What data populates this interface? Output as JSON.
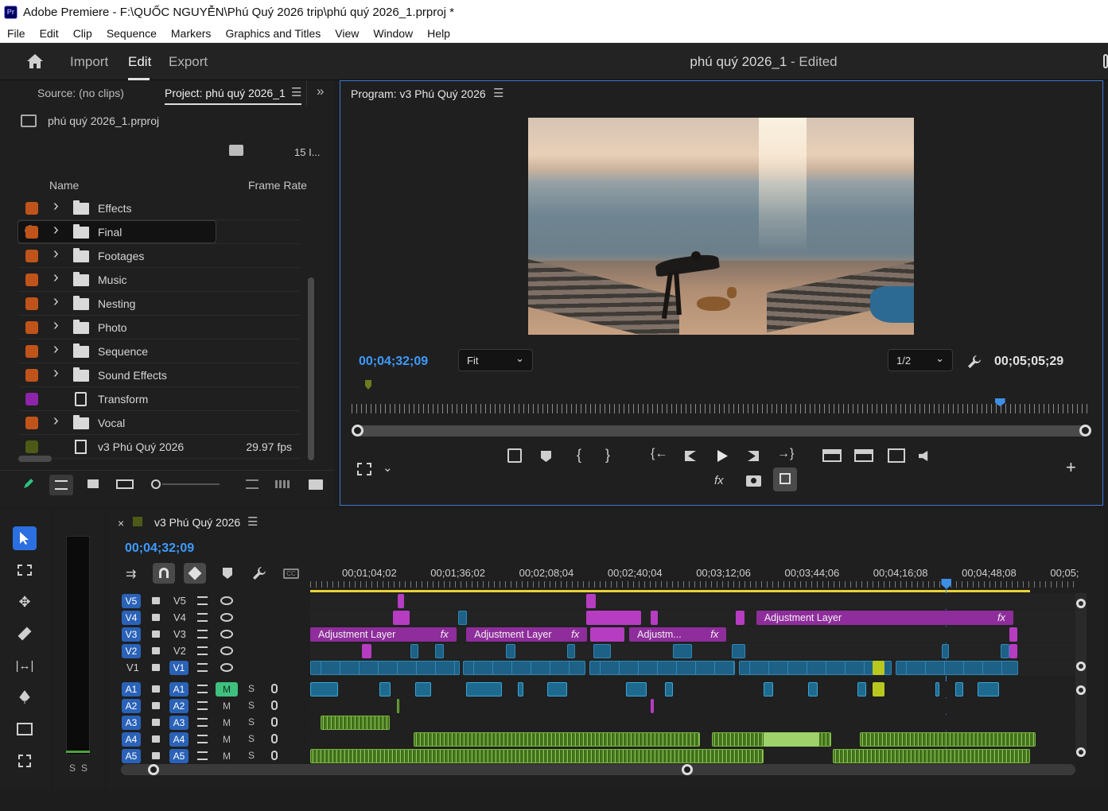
{
  "titlebar": {
    "app_badge": "Pr",
    "title": "Adobe Premiere - F:\\QUỐC NGUYỄN\\Phú Quý 2026 trip\\phú quý 2026_1.prproj *"
  },
  "menu": [
    "File",
    "Edit",
    "Clip",
    "Sequence",
    "Markers",
    "Graphics and Titles",
    "View",
    "Window",
    "Help"
  ],
  "header": {
    "import": "Import",
    "edit": "Edit",
    "export": "Export",
    "doc_title": "phú quý 2026_1",
    "doc_status": " - Edited"
  },
  "project": {
    "source_tab": "Source: (no clips)",
    "project_tab": "Project: phú quý 2026_1",
    "file_name": "phú quý 2026_1.prproj",
    "item_count": "15 I...",
    "col_name": "Name",
    "col_fps": "Frame Rate",
    "items": [
      {
        "label": "Effects",
        "color": "#c0531a",
        "kind": "folder",
        "fps": ""
      },
      {
        "label": "Final",
        "color": "#c0531a",
        "kind": "folder",
        "fps": ""
      },
      {
        "label": "Footages",
        "color": "#c0531a",
        "kind": "folder",
        "fps": ""
      },
      {
        "label": "Music",
        "color": "#c0531a",
        "kind": "folder",
        "fps": ""
      },
      {
        "label": "Nesting",
        "color": "#c0531a",
        "kind": "folder",
        "fps": ""
      },
      {
        "label": "Photo",
        "color": "#c0531a",
        "kind": "folder",
        "fps": ""
      },
      {
        "label": "Sequence",
        "color": "#c0531a",
        "kind": "folder",
        "fps": ""
      },
      {
        "label": "Sound Effects",
        "color": "#c0531a",
        "kind": "folder",
        "fps": ""
      },
      {
        "label": "Transform",
        "color": "#8e24aa",
        "kind": "effect",
        "fps": ""
      },
      {
        "label": "Vocal",
        "color": "#c0531a",
        "kind": "folder",
        "fps": ""
      },
      {
        "label": "v3 Phú Quý 2026",
        "color": "#4d5a16",
        "kind": "sequence",
        "fps": "29.97 fps"
      }
    ]
  },
  "program": {
    "title": "Program: v3 Phú Quý 2026",
    "timecode_current": "00;04;32;09",
    "timecode_duration": "00;05;05;29",
    "zoom": "Fit",
    "resolution": "1/2",
    "playhead_fraction": 0.876
  },
  "timeline": {
    "sequence_name": "v3 Phú Quý 2026",
    "timecode": "00;04;32;09",
    "ruler_labels": [
      "00;01;04;02",
      "00;01;36;02",
      "00;02;08;04",
      "00;02;40;04",
      "00;03;12;06",
      "00;03;44;06",
      "00;04;16;08",
      "00;04;48;08",
      "00;05;"
    ],
    "playhead_fraction": 0.831,
    "meter_labels": [
      "S",
      "S"
    ],
    "video_tracks": [
      {
        "name": "V5",
        "src": "V5",
        "target": ""
      },
      {
        "name": "V4",
        "src": "V4",
        "target": ""
      },
      {
        "name": "V3",
        "src": "V3",
        "target": ""
      },
      {
        "name": "V2",
        "src": "V2",
        "target": ""
      },
      {
        "name": "V1",
        "src": "",
        "target": "V1"
      }
    ],
    "audio_tracks": [
      {
        "name": "A1",
        "src": "A1",
        "target": "A1",
        "mute": "M",
        "solo": "S",
        "mute_active": true
      },
      {
        "name": "A2",
        "src": "A2",
        "target": "A2",
        "mute": "M",
        "solo": "S",
        "mute_active": false
      },
      {
        "name": "A3",
        "src": "A3",
        "target": "A3",
        "mute": "M",
        "solo": "S",
        "mute_active": false
      },
      {
        "name": "A4",
        "src": "A4",
        "target": "A4",
        "mute": "M",
        "solo": "S",
        "mute_active": false
      },
      {
        "name": "A5",
        "src": "A5",
        "target": "A5",
        "mute": "M",
        "solo": "S",
        "mute_active": false
      }
    ],
    "clips": [
      {
        "track": 0,
        "start": 0.114,
        "width": 0.009,
        "kind": "pnk",
        "label": ""
      },
      {
        "track": 0,
        "start": 0.361,
        "width": 0.012,
        "kind": "pnk",
        "label": ""
      },
      {
        "track": 1,
        "start": 0.108,
        "width": 0.022,
        "kind": "pnk",
        "label": ""
      },
      {
        "track": 1,
        "start": 0.193,
        "width": 0.012,
        "kind": "vid",
        "label": ""
      },
      {
        "track": 1,
        "start": 0.361,
        "width": 0.071,
        "kind": "pnk",
        "label": ""
      },
      {
        "track": 1,
        "start": 0.445,
        "width": 0.009,
        "kind": "pnk",
        "label": ""
      },
      {
        "track": 1,
        "start": 0.556,
        "width": 0.012,
        "kind": "pnk",
        "label": ""
      },
      {
        "track": 1,
        "start": 0.583,
        "width": 0.336,
        "kind": "adj",
        "label": "Adjustment Layer"
      },
      {
        "track": 2,
        "start": 0.0,
        "width": 0.191,
        "kind": "adj",
        "label": "Adjustment Layer"
      },
      {
        "track": 2,
        "start": 0.204,
        "width": 0.158,
        "kind": "adj",
        "label": "Adjustment Layer"
      },
      {
        "track": 2,
        "start": 0.366,
        "width": 0.045,
        "kind": "pnk",
        "label": ""
      },
      {
        "track": 2,
        "start": 0.417,
        "width": 0.127,
        "kind": "adj",
        "label": "Adjustm..."
      },
      {
        "track": 2,
        "start": 0.914,
        "width": 0.01,
        "kind": "pnk",
        "label": ""
      },
      {
        "track": 3,
        "start": 0.068,
        "width": 0.012,
        "kind": "pnk",
        "label": ""
      },
      {
        "track": 3,
        "start": 0.131,
        "width": 0.01,
        "kind": "vid",
        "label": ""
      },
      {
        "track": 3,
        "start": 0.163,
        "width": 0.012,
        "kind": "vid",
        "label": ""
      },
      {
        "track": 3,
        "start": 0.256,
        "width": 0.012,
        "kind": "vid",
        "label": ""
      },
      {
        "track": 3,
        "start": 0.336,
        "width": 0.01,
        "kind": "vid",
        "label": ""
      },
      {
        "track": 3,
        "start": 0.37,
        "width": 0.023,
        "kind": "vid",
        "label": ""
      },
      {
        "track": 3,
        "start": 0.474,
        "width": 0.025,
        "kind": "vid",
        "label": ""
      },
      {
        "track": 3,
        "start": 0.551,
        "width": 0.018,
        "kind": "vid",
        "label": ""
      },
      {
        "track": 3,
        "start": 0.825,
        "width": 0.01,
        "kind": "vid",
        "label": ""
      },
      {
        "track": 3,
        "start": 0.902,
        "width": 0.012,
        "kind": "vid",
        "label": ""
      },
      {
        "track": 3,
        "start": 0.914,
        "width": 0.01,
        "kind": "pnk",
        "label": ""
      },
      {
        "track": 4,
        "start": 0.0,
        "width": 0.195,
        "kind": "vid",
        "label": ""
      },
      {
        "track": 4,
        "start": 0.2,
        "width": 0.16,
        "kind": "vid",
        "label": ""
      },
      {
        "track": 4,
        "start": 0.365,
        "width": 0.19,
        "kind": "vid",
        "label": ""
      },
      {
        "track": 4,
        "start": 0.56,
        "width": 0.2,
        "kind": "vid",
        "label": ""
      },
      {
        "track": 4,
        "start": 0.765,
        "width": 0.16,
        "kind": "vid",
        "label": ""
      },
      {
        "track": 4,
        "start": 0.735,
        "width": 0.016,
        "kind": "yel",
        "label": ""
      },
      {
        "track": 5,
        "start": 0.0,
        "width": 0.036,
        "kind": "aud",
        "label": ""
      },
      {
        "track": 5,
        "start": 0.09,
        "width": 0.015,
        "kind": "aud",
        "label": ""
      },
      {
        "track": 5,
        "start": 0.137,
        "width": 0.021,
        "kind": "aud",
        "label": ""
      },
      {
        "track": 5,
        "start": 0.204,
        "width": 0.047,
        "kind": "aud",
        "label": ""
      },
      {
        "track": 5,
        "start": 0.271,
        "width": 0.008,
        "kind": "aud",
        "label": ""
      },
      {
        "track": 5,
        "start": 0.31,
        "width": 0.026,
        "kind": "aud",
        "label": ""
      },
      {
        "track": 5,
        "start": 0.413,
        "width": 0.027,
        "kind": "aud",
        "label": ""
      },
      {
        "track": 5,
        "start": 0.464,
        "width": 0.01,
        "kind": "aud",
        "label": ""
      },
      {
        "track": 5,
        "start": 0.593,
        "width": 0.012,
        "kind": "aud",
        "label": ""
      },
      {
        "track": 5,
        "start": 0.651,
        "width": 0.012,
        "kind": "aud",
        "label": ""
      },
      {
        "track": 5,
        "start": 0.715,
        "width": 0.012,
        "kind": "aud",
        "label": ""
      },
      {
        "track": 5,
        "start": 0.735,
        "width": 0.016,
        "kind": "yel",
        "label": ""
      },
      {
        "track": 5,
        "start": 0.817,
        "width": 0.005,
        "kind": "aud",
        "label": ""
      },
      {
        "track": 5,
        "start": 0.843,
        "width": 0.01,
        "kind": "aud",
        "label": ""
      },
      {
        "track": 5,
        "start": 0.872,
        "width": 0.028,
        "kind": "aud",
        "label": ""
      },
      {
        "track": 6,
        "start": 0.113,
        "width": 0.003,
        "kind": "grn",
        "label": ""
      },
      {
        "track": 6,
        "start": 0.445,
        "width": 0.004,
        "kind": "pnk",
        "label": ""
      },
      {
        "track": 7,
        "start": 0.013,
        "width": 0.091,
        "kind": "grn",
        "label": ""
      },
      {
        "track": 8,
        "start": 0.135,
        "width": 0.374,
        "kind": "grn",
        "label": ""
      },
      {
        "track": 8,
        "start": 0.525,
        "width": 0.156,
        "kind": "grn",
        "label": ""
      },
      {
        "track": 8,
        "start": 0.593,
        "width": 0.072,
        "kind": "lgrn",
        "label": ""
      },
      {
        "track": 8,
        "start": 0.718,
        "width": 0.23,
        "kind": "grn",
        "label": ""
      },
      {
        "track": 9,
        "start": 0.0,
        "width": 0.592,
        "kind": "grn",
        "label": ""
      },
      {
        "track": 9,
        "start": 0.683,
        "width": 0.258,
        "kind": "grn",
        "label": ""
      }
    ]
  }
}
